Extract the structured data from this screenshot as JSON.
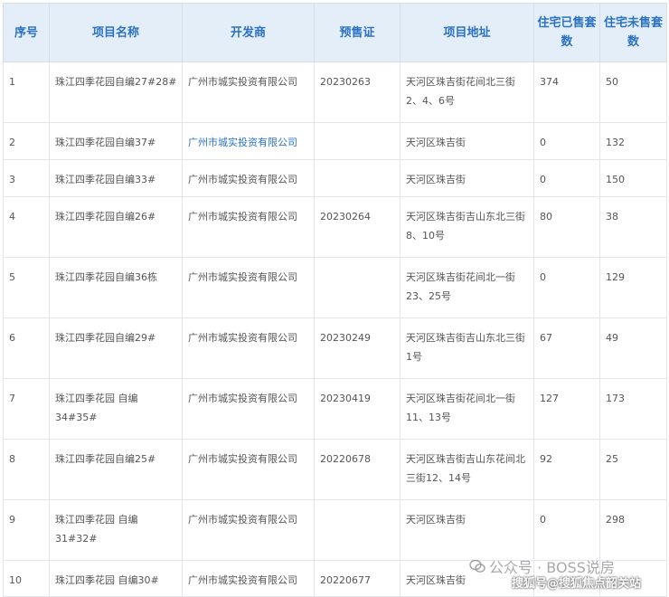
{
  "table": {
    "headers": [
      "序号",
      "项目名称",
      "开发商",
      "预售证",
      "项目地址",
      "住宅已售套数",
      "住宅未售套数"
    ],
    "rows": [
      [
        "1",
        "珠江四季花园自编27#28#",
        "广州市城实投资有限公司",
        "20230263",
        "天河区珠吉街花间北三街2、4、6号",
        "374",
        "50"
      ],
      [
        "2",
        "珠江四季花园自编37#",
        "广州市城实投资有限公司",
        "",
        "天河区珠吉街",
        "0",
        "132"
      ],
      [
        "3",
        "珠江四季花园自编33#",
        "广州市城实投资有限公司",
        "",
        "天河区珠吉街",
        "0",
        "150"
      ],
      [
        "4",
        "珠江四季花园自编26#",
        "广州市城实投资有限公司",
        "20230264",
        "天河区珠吉街吉山东北三街8、10号",
        "80",
        "38"
      ],
      [
        "5",
        "珠江四季花园自编36栋",
        "广州市城实投资有限公司",
        "",
        "天河区珠吉街花间北一街23、25号",
        "0",
        "129"
      ],
      [
        "6",
        "珠江四季花园自编29#",
        "广州市城实投资有限公司",
        "20230249",
        "天河区珠吉街吉山东北三街1号",
        "67",
        "49"
      ],
      [
        "7",
        "珠江四季花园 自编34#35#",
        "广州市城实投资有限公司",
        "20230419",
        "天河区珠吉街花间北一街11、13号",
        "127",
        "173"
      ],
      [
        "8",
        "珠江四季花园自编25#",
        "广州市城实投资有限公司",
        "20220678",
        "天河区珠吉街吉山东花间北三街12、14号",
        "92",
        "25"
      ],
      [
        "9",
        "珠江四季花园 自编31#32#",
        "广州市城实投资有限公司",
        "",
        "天河区珠吉街",
        "0",
        "298"
      ],
      [
        "10",
        "珠江四季花园 自编30#",
        "广州市城实投资有限公司",
        "20220677",
        "天河区珠吉街",
        "",
        ""
      ]
    ]
  },
  "watermark": {
    "top": "公众号 · BOSS说房",
    "bottom": "搜狐号@搜狐焦点韶关站"
  }
}
